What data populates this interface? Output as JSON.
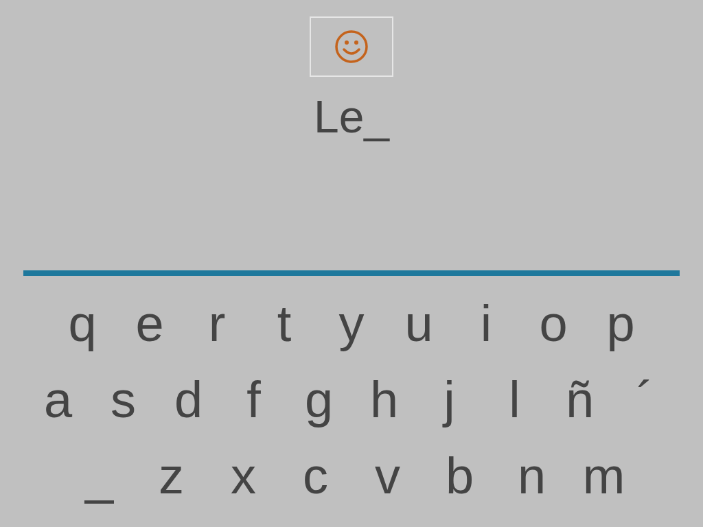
{
  "display": {
    "text": "Le_"
  },
  "keyboard": {
    "rows": [
      [
        "q",
        "e",
        "r",
        "t",
        "y",
        "u",
        "i",
        "o",
        "p"
      ],
      [
        "a",
        "s",
        "d",
        "f",
        "g",
        "h",
        "j",
        "l",
        "ñ",
        "´"
      ],
      [
        "_",
        "z",
        "x",
        "c",
        "v",
        "b",
        "n",
        "m"
      ]
    ]
  }
}
